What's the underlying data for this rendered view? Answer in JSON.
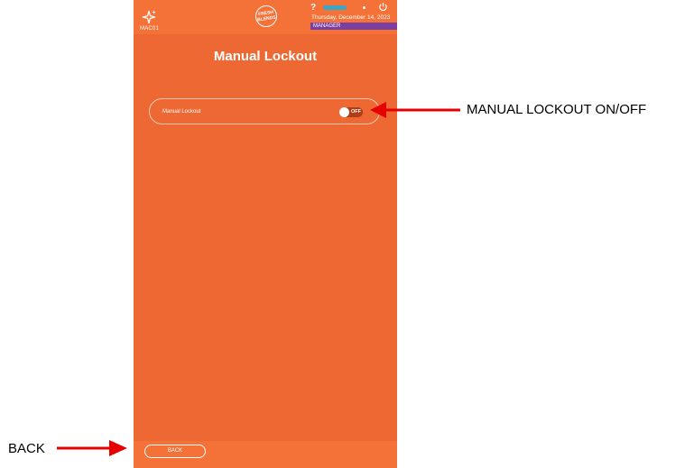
{
  "header": {
    "device_id": "MAC01",
    "logo_text_line1": "FRESH",
    "logo_text_line2": "BLENDS",
    "help_icon": "?",
    "date": "Thursday, December 14, 2023",
    "role": "MANAGER",
    "icons": [
      "sparkle-icon",
      "help-icon",
      "status-indicator",
      "dot-icon",
      "power-icon"
    ]
  },
  "main": {
    "title": "Manual Lockout",
    "setting": {
      "label": "Manual Lockout",
      "toggle_state": "OFF"
    }
  },
  "footer": {
    "back_label": "BACK"
  },
  "annotations": {
    "toggle_callout": "MANUAL LOCKOUT ON/OFF",
    "back_callout": "BACK"
  },
  "colors": {
    "background": "#ed6832",
    "bars": "#f47138",
    "role_bar": "#7a3fa0",
    "status_pill": "#3ca6c6",
    "toggle_off": "#b13c18",
    "arrow": "#e60000"
  }
}
